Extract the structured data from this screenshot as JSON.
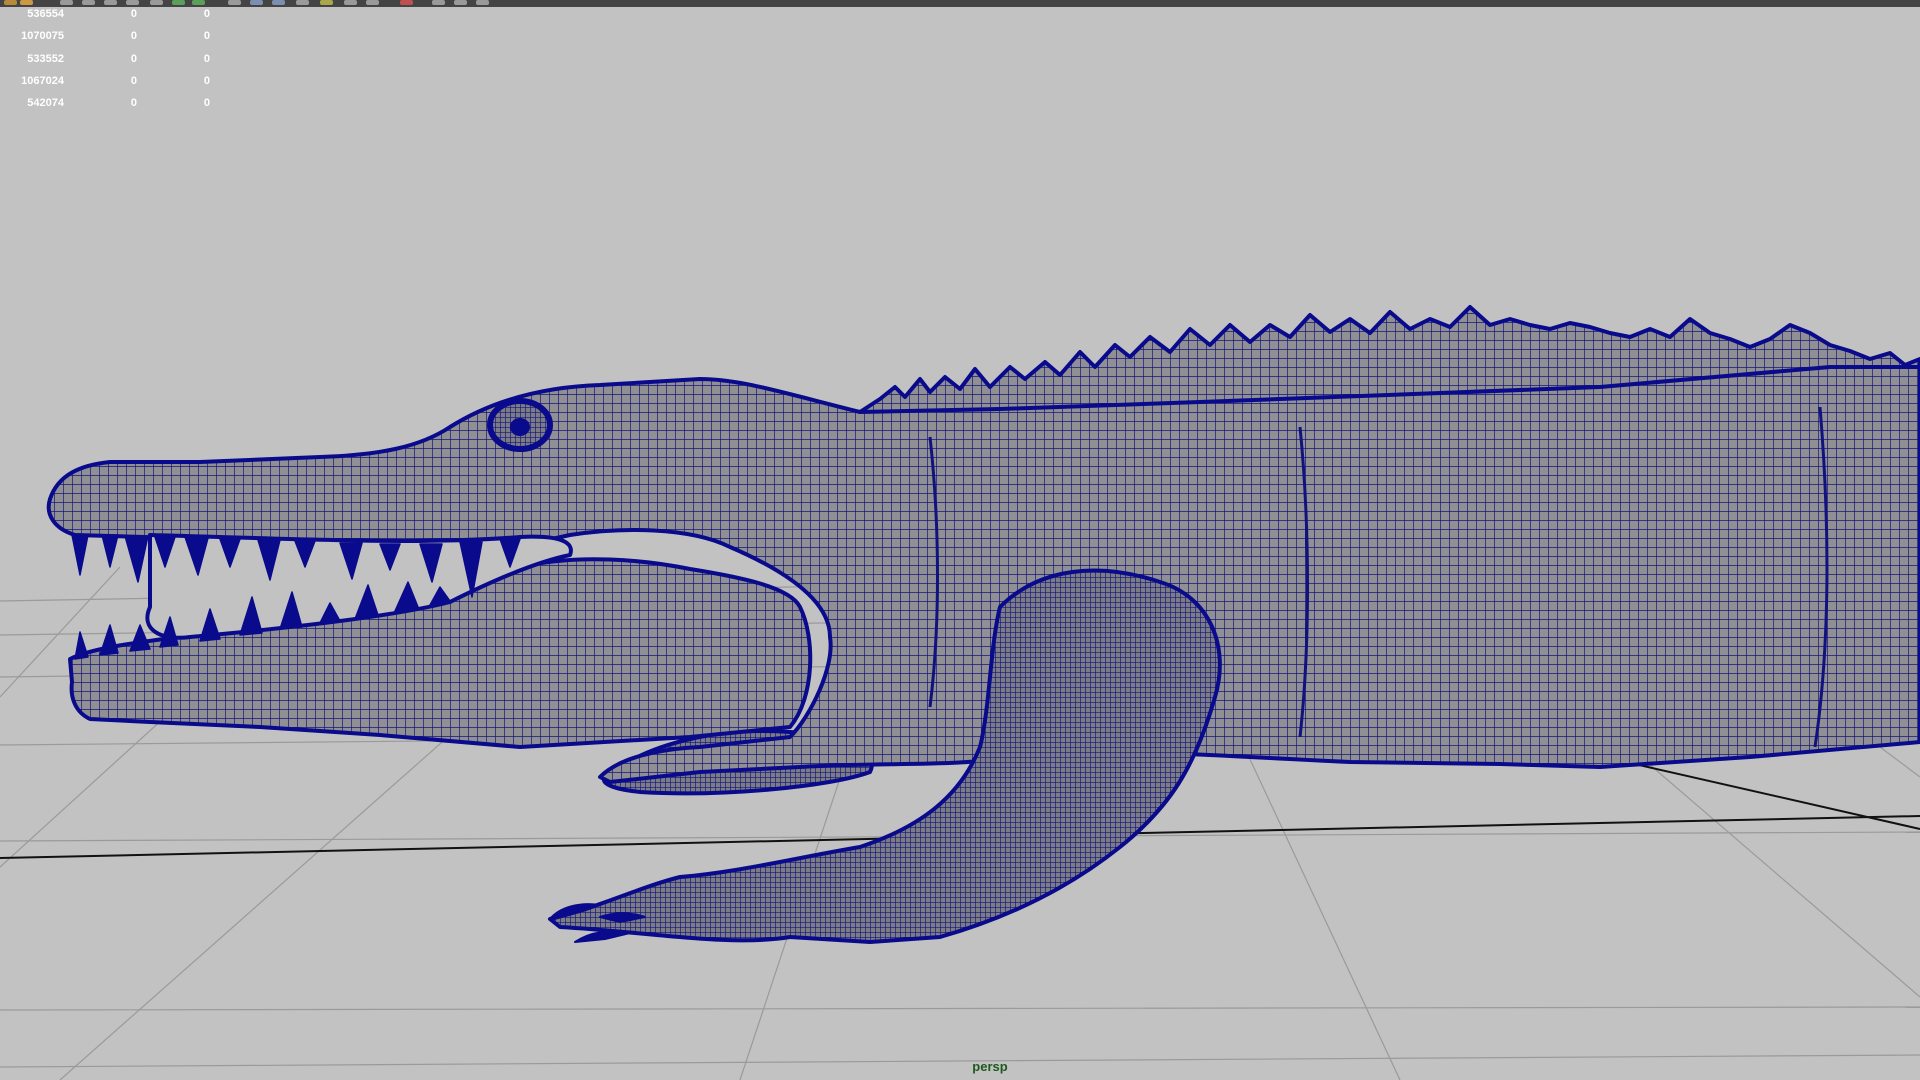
{
  "hud": {
    "rows": [
      {
        "a": "536554",
        "b": "0",
        "c": "0"
      },
      {
        "a": "1070075",
        "b": "0",
        "c": "0"
      },
      {
        "a": "533552",
        "b": "0",
        "c": "0"
      },
      {
        "a": "1067024",
        "b": "0",
        "c": "0"
      },
      {
        "a": "542074",
        "b": "0",
        "c": "0"
      }
    ]
  },
  "viewport": {
    "camera": "persp",
    "wireframe_color": "#0a0a8c",
    "background_color": "#c2c2c2",
    "grid_color": "#9a9a9a",
    "axis_color": "#111111",
    "camera_label_color": "#1d5a1d"
  }
}
